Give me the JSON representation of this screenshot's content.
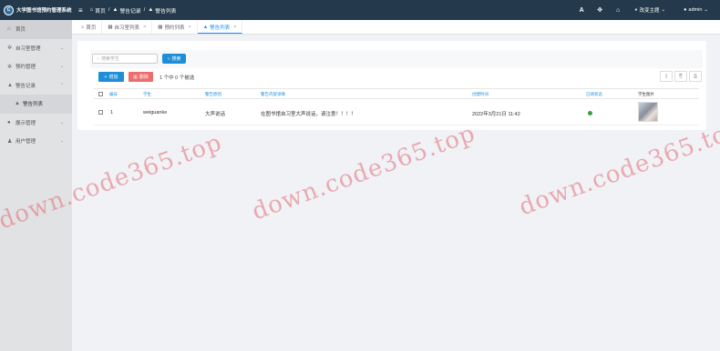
{
  "app": {
    "logo_text": "C",
    "title": "大学图书馆预约管理系统"
  },
  "breadcrumb": {
    "home": "首页",
    "sep1": "/",
    "section": "警告记录",
    "sep2": "/",
    "page": "警告列表"
  },
  "header": {
    "font_tool": "A",
    "fullscreen_tool": "✥",
    "home_tool": "⌂",
    "theme_label": "改变主题",
    "user_label": "admin"
  },
  "sidebar": {
    "items": [
      {
        "label": "首页"
      },
      {
        "label": "自习室管理"
      },
      {
        "label": "预约管理"
      },
      {
        "label": "警告记录"
      },
      {
        "label": "警告列表"
      },
      {
        "label": "展示管理"
      },
      {
        "label": "用户管理"
      }
    ]
  },
  "tabs": [
    {
      "label": "首页"
    },
    {
      "label": "自习室列表"
    },
    {
      "label": "预约列表"
    },
    {
      "label": "警告列表"
    }
  ],
  "search": {
    "placeholder": "搜索学生",
    "button_label": "搜索"
  },
  "actions": {
    "add_label": "增加",
    "delete_label": "删除",
    "selection_text": "1 个中 0 个被选"
  },
  "table": {
    "columns": [
      "编号",
      "学生",
      "警告原因",
      "警告内容详情",
      "创建时间",
      "已阅状态",
      "学生图片"
    ],
    "rows": [
      {
        "id": "1",
        "student": "weiguanke",
        "reason": "大声说话",
        "detail": "在图书馆自习室大声说话，请注意！！！！",
        "created": "2022年3月21日 11:42",
        "read_status_color": "#3aa13a"
      }
    ]
  },
  "watermark": "down.code365.top"
}
